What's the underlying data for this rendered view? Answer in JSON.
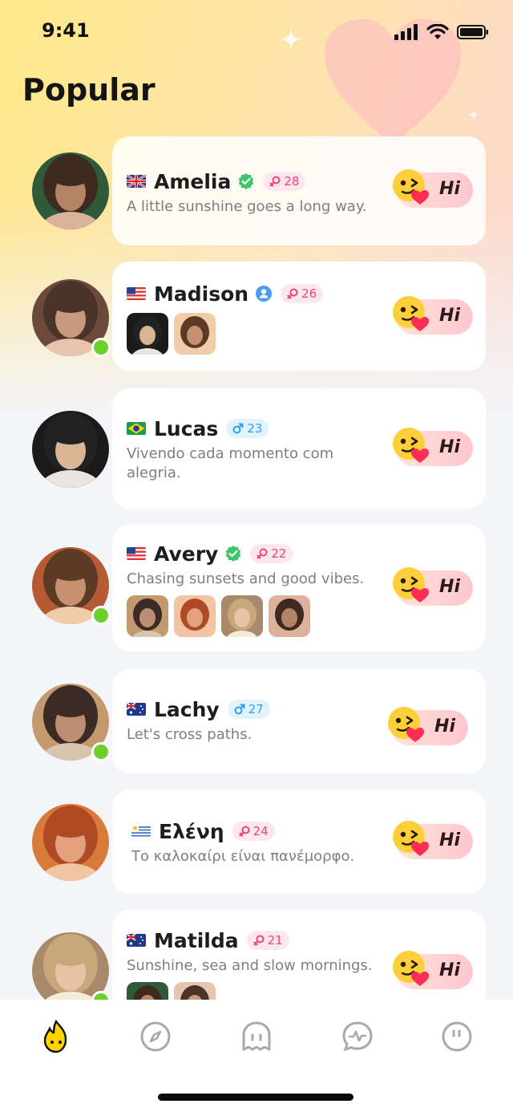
{
  "status": {
    "time": "9:41"
  },
  "page": {
    "title": "Popular"
  },
  "hi_label": "Hi",
  "users": [
    {
      "name": "Amelia",
      "flag": "uk",
      "verified": "green",
      "gender": "female",
      "age": "28",
      "bio": "A little sunshine goes a long way.",
      "online": false,
      "photos": 0
    },
    {
      "name": "Madison",
      "flag": "us",
      "verified": "blue",
      "gender": "female",
      "age": "26",
      "bio": "",
      "online": true,
      "photos": 2
    },
    {
      "name": "Lucas",
      "flag": "br",
      "verified": "none",
      "gender": "male",
      "age": "23",
      "bio": "Vivendo cada momento com alegria.",
      "online": false,
      "photos": 0
    },
    {
      "name": "Avery",
      "flag": "us",
      "verified": "green",
      "gender": "female",
      "age": "22",
      "bio": "Chasing sunsets and good vibes.",
      "online": true,
      "photos": 4
    },
    {
      "name": "Lachy",
      "flag": "au",
      "verified": "none",
      "gender": "male",
      "age": "27",
      "bio": "Let's cross paths.",
      "online": true,
      "photos": 0
    },
    {
      "name": "Ελένη",
      "flag": "uy",
      "verified": "none",
      "gender": "female",
      "age": "24",
      "bio": "Το καλοκαίρι είναι πανέμορφο.",
      "online": false,
      "photos": 0
    },
    {
      "name": "Matilda",
      "flag": "au",
      "verified": "none",
      "gender": "female",
      "age": "21",
      "bio": "Sunshine, sea and slow mornings.",
      "online": true,
      "photos": 2
    }
  ],
  "tabs": [
    {
      "icon": "flame-face-icon",
      "active": true
    },
    {
      "icon": "compass-icon",
      "active": false
    },
    {
      "icon": "ghost-chat-icon",
      "active": false
    },
    {
      "icon": "activity-bubble-icon",
      "active": false
    },
    {
      "icon": "quote-bubble-icon",
      "active": false
    }
  ],
  "colors": {
    "female": "#f0427f",
    "male": "#2ba2ee",
    "verified_green": "#3cc56a",
    "verified_blue": "#4a9bf0",
    "online": "#6ad12b"
  }
}
